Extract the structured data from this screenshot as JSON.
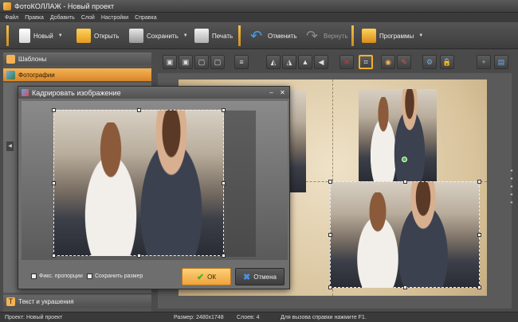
{
  "window": {
    "title": "ФотоКОЛЛАЖ - Новый проект"
  },
  "menu": [
    "Файл",
    "Правка",
    "Добавить",
    "Слой",
    "Настройки",
    "Справка"
  ],
  "toolbar": {
    "new_label": "Новый",
    "open_label": "Открыть",
    "save_label": "Сохранить",
    "print_label": "Печать",
    "undo_label": "Отменить",
    "redo_label": "Вернуть",
    "programs_label": "Программы"
  },
  "sidebar": {
    "templates_label": "Шаблоны",
    "photos_label": "Фотографии",
    "text_label": "Текст и украшения"
  },
  "crop_dialog": {
    "title": "Кадрировать изображение",
    "keep_ratio_label": "Фикс. пропорции",
    "keep_size_label": "Сохранить размер",
    "ok_label": "ОК",
    "cancel_label": "Отмена"
  },
  "status": {
    "project": "Проект: Новый проект",
    "size": "Размер: 2480x1748",
    "layers": "Слоев: 4",
    "help": "Для вызова справки нажмите F1."
  },
  "colors": {
    "accent": "#f0a33c",
    "panel": "#555555",
    "active_tool_border": "#f2b02a"
  }
}
